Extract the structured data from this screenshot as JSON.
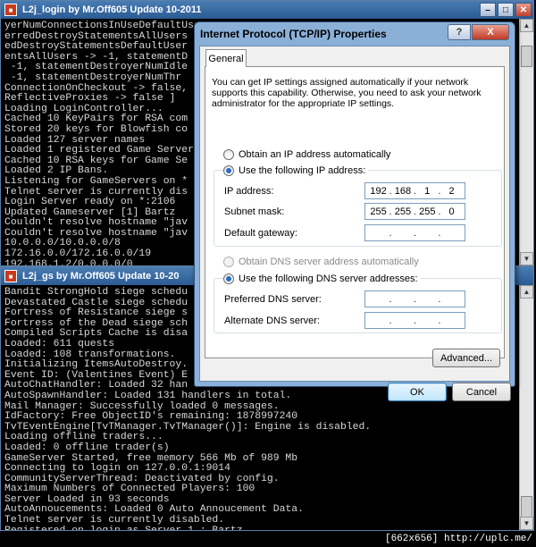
{
  "console_top": {
    "title": "L2j_login by Mr.Off605   Update 10-2011",
    "lines": [
      "yerNumConnectionsInUseDefaultUser",
      "erredDestroyStatementsAllUsers",
      "edDestroyStatementsDefaultUser",
      "entsAllUsers -> -1, statementD",
      " -1, statementDestroyerNumIdle",
      " -1, statementDestroyerNumThr",
      "ConnectionOnCheckout -> false,",
      "ReflectiveProxies -> false ]",
      "Loading LoginController...",
      "Cached 10 KeyPairs for RSA com",
      "Stored 20 keys for Blowfish co",
      "Loaded 127 server names",
      "Loaded 1 registered Game Server",
      "Cached 10 RSA keys for Game Se",
      "Loaded 2 IP Bans.",
      "Listening for GameServers on *",
      "Telnet server is currently dis",
      "Login Server ready on *:2106",
      "Updated Gameserver [1] Bartz",
      "Couldn't resolve hostname \"jav",
      "Couldn't resolve hostname \"jav",
      "10.0.0.0/10.0.0.0/8",
      "172.16.0.0/172.16.0.0/19",
      "192.168.1.2/0.0.0.0/0"
    ]
  },
  "console_bottom": {
    "title": "L2j_gs by Mr.Off605   Update 10-20",
    "lines": [
      "Bandit StrongHold siege schedu",
      "Devastated Castle siege schedu",
      "Fortress of Resistance siege s",
      "Fortress of the Dead siege sch",
      "Compiled Scripts Cache is disa",
      "Loaded: 611 quests",
      "Loaded: 108 transformations.",
      "Initializing ItemsAutoDestroy.",
      "Event ID: (Valentines Event) E",
      "AutoChatHandler: Loaded 32 han",
      "AutoSpawnHandler: Loaded 131 handlers in total.",
      "Mail Manager: Successfully loaded 0 messages.",
      "IdFactory: Free ObjectID's remaining: 1878997240",
      "TvTEventEngine[TvTManager.TvTManager()]: Engine is disabled.",
      "Loading offline traders...",
      "Loaded: 0 offline trader(s)",
      "GameServer Started, free memory 566 Mb of 989 Mb",
      "Connecting to login on 127.0.0.1:9014",
      "CommunityServerThread: Deactivated by config.",
      "Maximum Numbers of Connected Players: 100",
      "Server Loaded in 93 seconds",
      "AutoAnnoucements: Loaded 0 Auto Annoucement Data.",
      "Telnet server is currently disabled.",
      "Registered on login as Server 1 : Bartz"
    ]
  },
  "dialog": {
    "title": "Internet Protocol (TCP/IP) Properties",
    "help_glyph": "?",
    "close_glyph": "X",
    "tab_general": "General",
    "intro": "You can get IP settings assigned automatically if your network supports this capability. Otherwise, you need to ask your network administrator for the appropriate IP settings.",
    "ip_auto_label": "Obtain an IP address automatically",
    "ip_manual_label": "Use the following IP address:",
    "ip_label": "IP address:",
    "ip_value": [
      "192",
      "168",
      "1",
      "2"
    ],
    "subnet_label": "Subnet mask:",
    "subnet_value": [
      "255",
      "255",
      "255",
      "0"
    ],
    "gateway_label": "Default gateway:",
    "gateway_value": [
      "",
      "",
      "",
      ""
    ],
    "dns_auto_label": "Obtain DNS server address automatically",
    "dns_manual_label": "Use the following DNS server addresses:",
    "dns_pref_label": "Preferred DNS server:",
    "dns_alt_label": "Alternate DNS server:",
    "advanced_label": "Advanced...",
    "ok_label": "OK",
    "cancel_label": "Cancel",
    "selected_ip_mode": "manual",
    "selected_dns_mode": "manual"
  },
  "footer": "[662x656] http://uplc.me/"
}
